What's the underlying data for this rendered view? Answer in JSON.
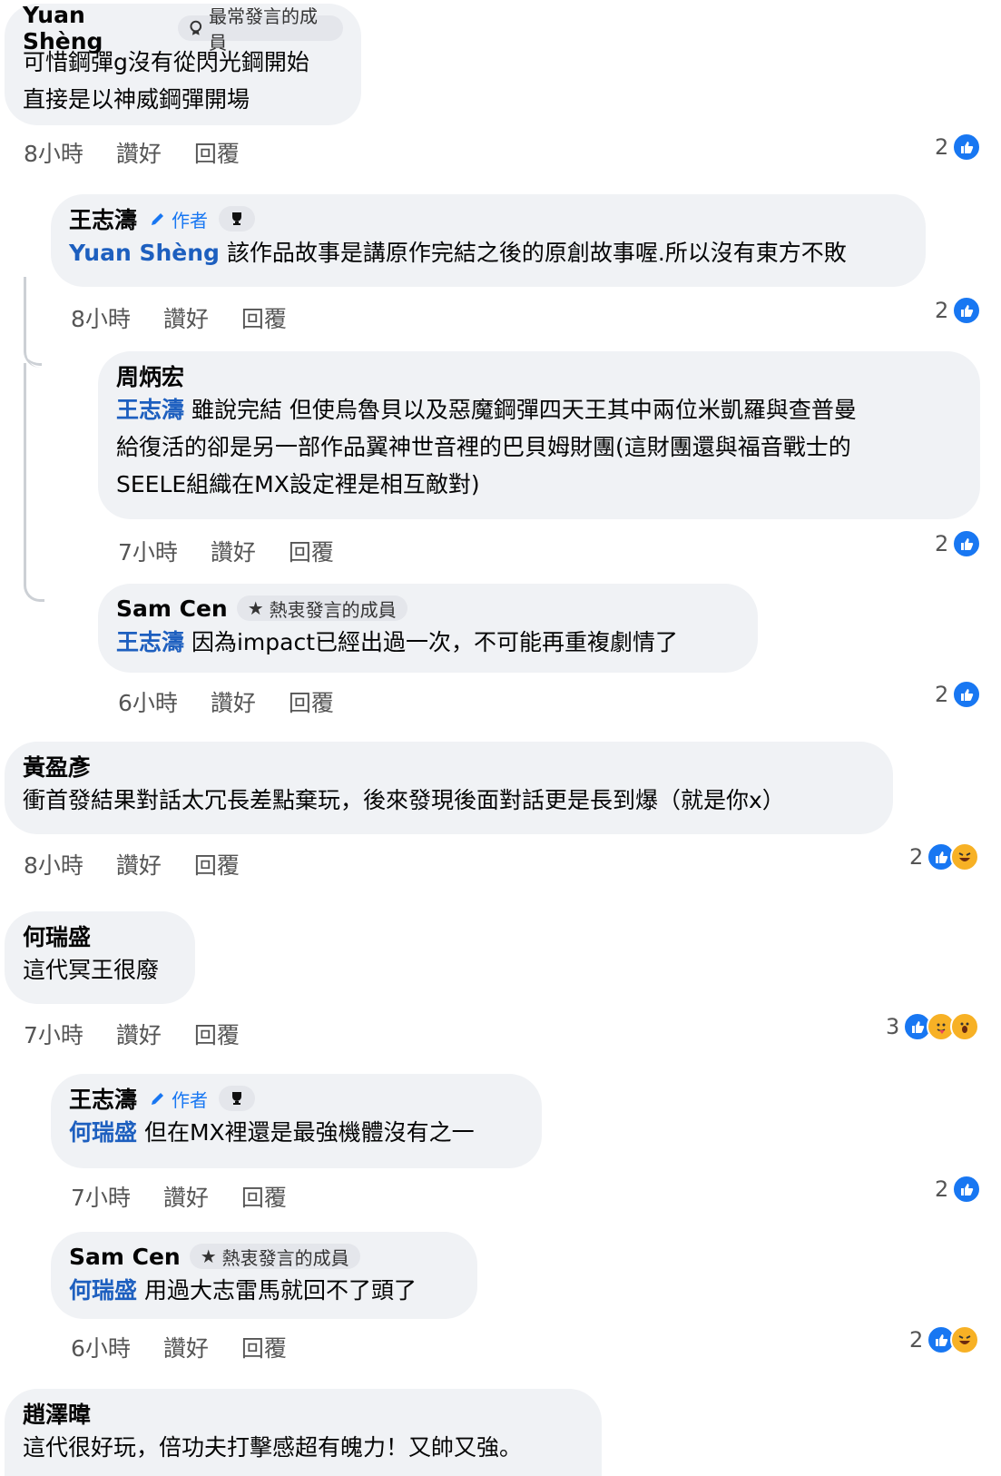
{
  "actions": {
    "like": "讚好",
    "reply": "回覆"
  },
  "comments": [
    {
      "name": "Yuan Shèng",
      "badge": "最常發言的成員",
      "line1": "可惜鋼彈g沒有從閃光鋼開始",
      "line2": "直接是以神威鋼彈開場",
      "time": "8小時",
      "count": "2",
      "reactions": [
        "like-icon"
      ]
    },
    {
      "name": "王志濤",
      "badge": "作者",
      "mention": "Yuan Shèng",
      "line1": "該作品故事是講原作完結之後的原創故事喔.所以沒有東方不敗",
      "time": "8小時",
      "count": "2",
      "reactions": [
        "like-icon"
      ]
    },
    {
      "name": "周炳宏",
      "mention": "王志濤",
      "line1": "雖說完結 但使烏魯貝以及惡魔鋼彈四天王其中兩位米凱羅與查普曼",
      "line2": "給復活的卻是另一部作品翼神世音裡的巴貝姆財團(這財團還與福音戰士的",
      "line3": "SEELE組織在MX設定裡是相互敵對)",
      "time": "7小時",
      "count": "2",
      "reactions": [
        "like-icon"
      ]
    },
    {
      "name": "Sam Cen",
      "badge": "熱衷發言的成員",
      "mention": "王志濤",
      "line1": "因為impact已經出過一次，不可能再重複劇情了",
      "time": "6小時",
      "count": "2",
      "reactions": [
        "like-icon"
      ]
    },
    {
      "name": "黃盈彥",
      "line1": "衝首發結果對話太冗長差點棄玩，後來發現後面對話更是長到爆（就是你x）",
      "time": "8小時",
      "count": "2",
      "reactions": [
        "like-icon",
        "haha-icon"
      ]
    },
    {
      "name": "何瑞盛",
      "line1": "這代冥王很廢",
      "time": "7小時",
      "count": "3",
      "reactions": [
        "like-icon",
        "care-icon",
        "wow-icon"
      ]
    },
    {
      "name": "王志濤",
      "badge": "作者",
      "mention": "何瑞盛",
      "line1": "但在MX裡還是最強機體沒有之一",
      "time": "7小時",
      "count": "2",
      "reactions": [
        "like-icon"
      ]
    },
    {
      "name": "Sam Cen",
      "badge": "熱衷發言的成員",
      "mention": "何瑞盛",
      "line1": "用過大志雷馬就回不了頭了",
      "time": "6小時",
      "count": "2",
      "reactions": [
        "like-icon",
        "haha-icon"
      ]
    },
    {
      "name": "趙澤暐",
      "line1": "這代很好玩，倍功夫打擊感超有魄力！又帥又強。"
    }
  ]
}
